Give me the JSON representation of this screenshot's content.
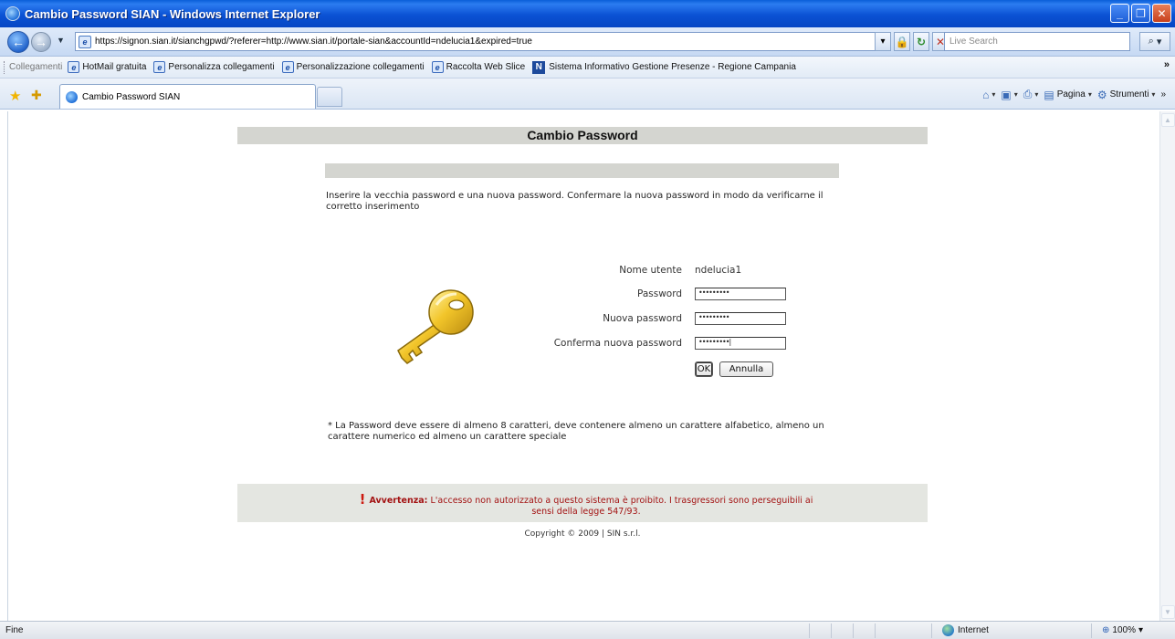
{
  "window": {
    "title": "Cambio Password SIAN - Windows Internet Explorer",
    "minimize_icon": "minimize-icon",
    "maximize_icon": "maximize-icon",
    "close_icon": "close-icon"
  },
  "address_bar": {
    "url": "https://signon.sian.it/sianchgpwd/?referer=http://www.sian.it/portale-sian&accountId=ndelucia1&expired=true",
    "search_placeholder": "Live Search"
  },
  "links_bar": {
    "label": "Collegamenti",
    "items": [
      {
        "label": "HotMail gratuita",
        "icon": "ie-page-icon"
      },
      {
        "label": "Personalizza collegamenti",
        "icon": "ie-page-icon"
      },
      {
        "label": "Personalizzazione collegamenti",
        "icon": "ie-page-icon"
      },
      {
        "label": "Raccolta Web Slice",
        "icon": "ie-page-icon"
      },
      {
        "label": "Sistema Informativo Gestione Presenze - Regione Campania",
        "icon": "sian-logo-icon"
      }
    ]
  },
  "tabs": {
    "active_label": "Cambio Password SIAN"
  },
  "command_bar": {
    "page_label": "Pagina",
    "tools_label": "Strumenti"
  },
  "page": {
    "heading": "Cambio Password",
    "intro": "Inserire la vecchia password e una nuova password. Confermare la nuova password in modo da verificarne il corretto inserimento",
    "form": {
      "username_label": "Nome utente",
      "username_value": "ndelucia1",
      "password_label": "Password",
      "password_value": "•••••••••",
      "new_password_label": "Nuova password",
      "new_password_value": "•••••••••",
      "confirm_label": "Conferma nuova password",
      "confirm_value": "•••••••••|",
      "ok_label": "OK",
      "cancel_label": "Annulla"
    },
    "note": "* La Password deve essere di almeno 8 caratteri, deve contenere almeno un carattere alfabetico, almeno un carattere numerico ed almeno un carattere speciale",
    "warning": {
      "mark": "!",
      "title": "Avvertenza:",
      "text": "L'accesso non autorizzato a questo sistema è proibito. I trasgressori sono perseguibili ai sensi della legge 547/93."
    },
    "copyright": "Copyright © 2009 | SIN s.r.l."
  },
  "status_bar": {
    "status": "Fine",
    "zone": "Internet",
    "zoom": "100%"
  }
}
